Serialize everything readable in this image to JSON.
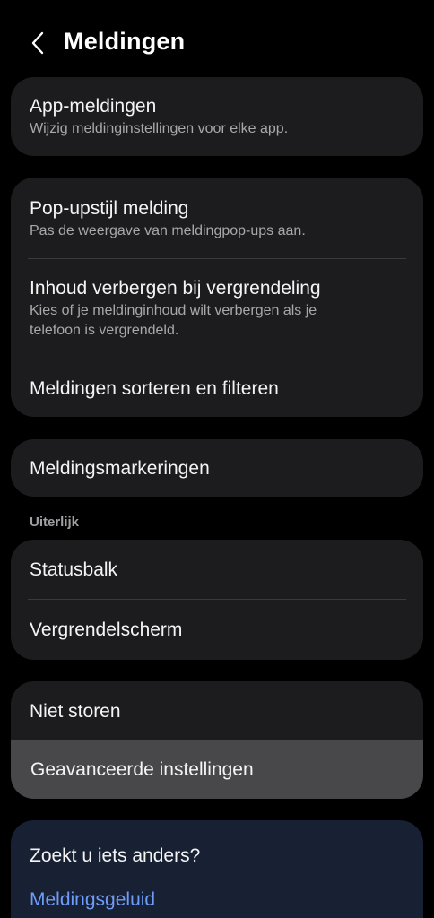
{
  "header": {
    "title": "Meldingen"
  },
  "cards": {
    "app": {
      "title": "App-meldingen",
      "subtitle": "Wijzig meldinginstellingen voor elke app."
    },
    "popup": {
      "title": "Pop-upstijl melding",
      "subtitle": "Pas de weergave van meldingpop-ups aan."
    },
    "hide": {
      "title": "Inhoud verbergen bij vergrendeling",
      "subtitle_line1": "Kies of je meldinginhoud wilt verbergen als je",
      "subtitle_line2": "telefoon is vergrendeld."
    },
    "sort": {
      "title": "Meldingen sorteren en filteren"
    },
    "badges": {
      "title": "Meldingsmarkeringen"
    }
  },
  "appearance": {
    "label": "Uiterlijk",
    "statusbar": "Statusbalk",
    "lockscreen": "Vergrendelscherm"
  },
  "more": {
    "dnd": "Niet storen",
    "advanced": "Geavanceerde instellingen"
  },
  "suggest": {
    "title": "Zoekt u iets anders?",
    "link": "Meldingsgeluid"
  },
  "colors": {
    "background": "#000000",
    "card": "#1c1c1e",
    "highlight": "#48484a",
    "link": "#6f9cf7",
    "suggest_card": "#182033"
  },
  "icons": {
    "back": "chevron-left-icon"
  }
}
